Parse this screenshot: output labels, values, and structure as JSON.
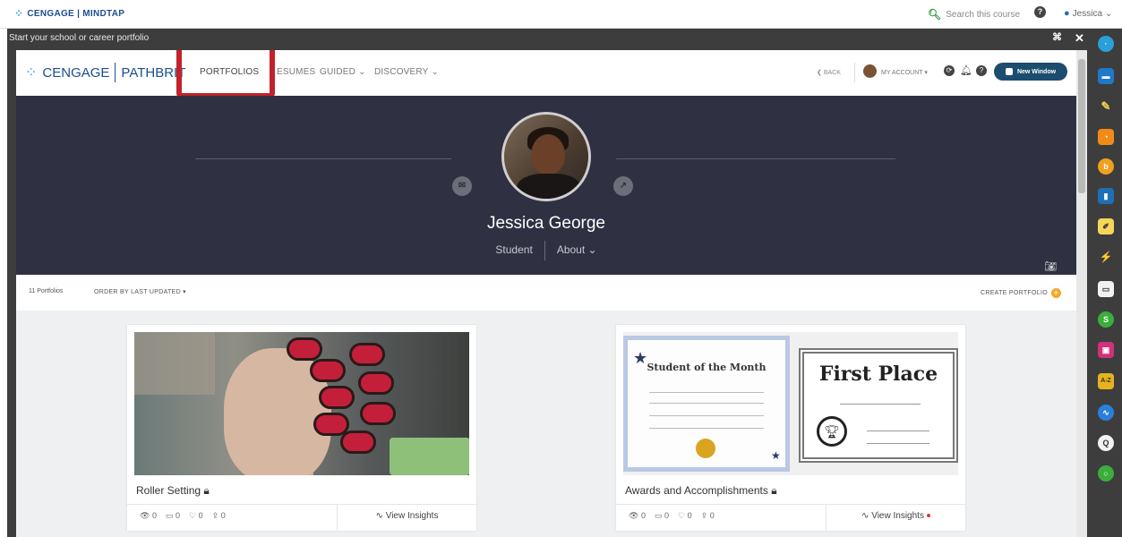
{
  "topbar": {
    "brand": "CENGAGE | MINDTAP",
    "search_label": "Search this course",
    "user_name": "Jessica"
  },
  "dialog": {
    "title": "Start your school or career portfolio"
  },
  "nav": {
    "brand": "CENGAGE",
    "product": "PATHBRITE",
    "product_visible": "PATHBRIT",
    "items": {
      "portfolios": "PORTFOLIOS",
      "resumes": "ESUMES",
      "guided": "GUIDED",
      "discovery": "DISCOVERY"
    },
    "back": "BACK",
    "account": "MY ACCOUNT",
    "new_window": "New Window"
  },
  "profile": {
    "name": "Jessica George",
    "role": "Student",
    "about": "About"
  },
  "toolbar": {
    "count": "11 Portfolios",
    "order": "ORDER BY LAST UPDATED",
    "create": "CREATE PORTFOLIO"
  },
  "cards": [
    {
      "title": "Roller Setting",
      "views": "0",
      "comments": "0",
      "likes": "0",
      "shares": "0",
      "insights": "View Insights"
    },
    {
      "title": "Awards and Accomplishments",
      "views": "0",
      "comments": "0",
      "likes": "0",
      "shares": "0",
      "insights": "View Insights",
      "cert1_title": "Student of the Month",
      "cert2_title": "First Place"
    }
  ],
  "colors": {
    "highlight": "#c2222a",
    "hero_bg": "#2f3142",
    "brand": "#1b4d8f"
  }
}
